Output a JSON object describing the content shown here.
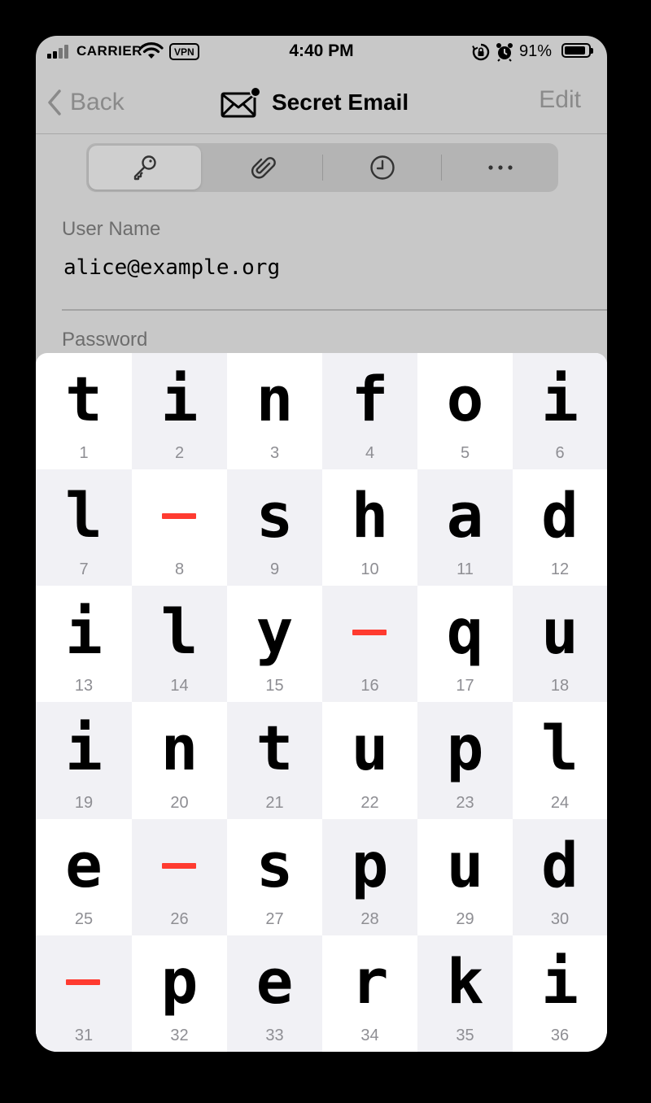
{
  "status_bar": {
    "carrier": "CARRIER",
    "vpn": "VPN",
    "time": "4:40 PM",
    "battery_percent": "91%",
    "battery_level": 0.91,
    "icons": [
      "signal-icon",
      "wifi-icon",
      "rotation-lock-icon",
      "alarm-icon",
      "battery-icon"
    ]
  },
  "nav": {
    "back_label": "Back",
    "title": "Secret Email",
    "title_icon": "envelope-icon",
    "edit_label": "Edit"
  },
  "segments": [
    {
      "name": "key-icon",
      "selected": true
    },
    {
      "name": "paperclip-icon",
      "selected": false
    },
    {
      "name": "clock-icon",
      "selected": false
    },
    {
      "name": "more-icon",
      "selected": false
    }
  ],
  "fields": {
    "username_label": "User Name",
    "username_value": "alice@example.org",
    "password_label": "Password"
  },
  "password_grid": {
    "columns": 6,
    "separator_color": "#ff3b30",
    "cells": [
      {
        "n": "1",
        "c": "t"
      },
      {
        "n": "2",
        "c": "i"
      },
      {
        "n": "3",
        "c": "n"
      },
      {
        "n": "4",
        "c": "f"
      },
      {
        "n": "5",
        "c": "o"
      },
      {
        "n": "6",
        "c": "i"
      },
      {
        "n": "7",
        "c": "l"
      },
      {
        "n": "8",
        "c": "-"
      },
      {
        "n": "9",
        "c": "s"
      },
      {
        "n": "10",
        "c": "h"
      },
      {
        "n": "11",
        "c": "a"
      },
      {
        "n": "12",
        "c": "d"
      },
      {
        "n": "13",
        "c": "i"
      },
      {
        "n": "14",
        "c": "l"
      },
      {
        "n": "15",
        "c": "y"
      },
      {
        "n": "16",
        "c": "-"
      },
      {
        "n": "17",
        "c": "q"
      },
      {
        "n": "18",
        "c": "u"
      },
      {
        "n": "19",
        "c": "i"
      },
      {
        "n": "20",
        "c": "n"
      },
      {
        "n": "21",
        "c": "t"
      },
      {
        "n": "22",
        "c": "u"
      },
      {
        "n": "23",
        "c": "p"
      },
      {
        "n": "24",
        "c": "l"
      },
      {
        "n": "25",
        "c": "e"
      },
      {
        "n": "26",
        "c": "-"
      },
      {
        "n": "27",
        "c": "s"
      },
      {
        "n": "28",
        "c": "p"
      },
      {
        "n": "29",
        "c": "u"
      },
      {
        "n": "30",
        "c": "d"
      },
      {
        "n": "31",
        "c": "-"
      },
      {
        "n": "32",
        "c": "p"
      },
      {
        "n": "33",
        "c": "e"
      },
      {
        "n": "34",
        "c": "r"
      },
      {
        "n": "35",
        "c": "k"
      },
      {
        "n": "36",
        "c": "i"
      }
    ]
  }
}
